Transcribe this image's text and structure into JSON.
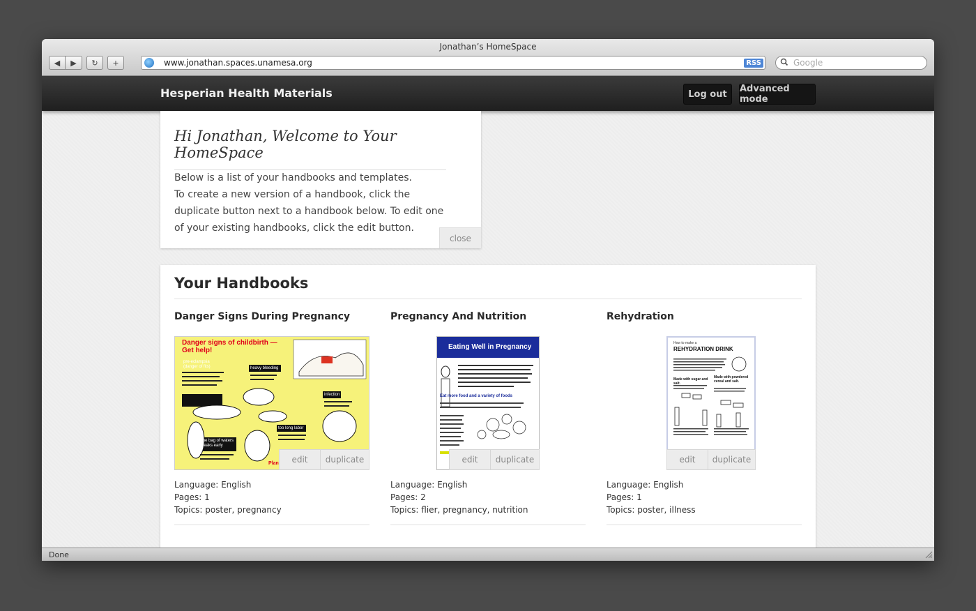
{
  "window": {
    "title": "Jonathan’s HomeSpace",
    "status": "Done"
  },
  "toolbar": {
    "back_icon": "◀",
    "forward_icon": "▶",
    "reload_icon": "↻",
    "add_icon": "+",
    "url": "www.jonathan.spaces.unamesa.org",
    "rss_label": "RSS",
    "search_placeholder": "Google"
  },
  "header": {
    "brand": "Hesperian Health Materials",
    "logout_label": "Log out",
    "advanced_label": "Advanced mode"
  },
  "welcome": {
    "title": "Hi Jonathan, Welcome to Your HomeSpace",
    "line1": "Below is a list of your handbooks and templates.",
    "line2": "To create a new version of a handbook, click the duplicate button next to a handbook below. To edit one of your existing handbooks, click the edit button.",
    "close_label": "close"
  },
  "handbooks": {
    "heading": "Your Handbooks",
    "items": [
      {
        "title": "Danger Signs During Pregnancy",
        "edit_label": "edit",
        "duplicate_label": "duplicate",
        "language": "Language: English",
        "pages": "Pages: 1",
        "topics": "Topics: poster, pregnancy",
        "thumb": {
          "title": "Danger signs of childbirth — Get help!",
          "l1": "pre-eclampsia (danger of fits)",
          "l2": "heavy bleeding",
          "l3": "infection",
          "l4": "too long labor",
          "l5": "The bag of waters breaks early",
          "l6": "Plan"
        }
      },
      {
        "title": "Pregnancy And Nutrition",
        "edit_label": "edit",
        "duplicate_label": "duplicate",
        "language": "Language: English",
        "pages": "Pages: 2",
        "topics": "Topics: flier, pregnancy, nutrition",
        "thumb": {
          "title": "Eating Well in Pregnancy",
          "sub": "Eat more food and a variety of foods"
        }
      },
      {
        "title": "Rehydration",
        "edit_label": "edit",
        "duplicate_label": "duplicate",
        "language": "Language: English",
        "pages": "Pages: 1",
        "topics": "Topics: poster, illness",
        "thumb": {
          "pre": "How to make a",
          "title": "REHYDRATION DRINK",
          "a": "Made with sugar and salt.",
          "b": "Made with powdered cereal and salt."
        }
      }
    ]
  },
  "colors": {
    "topbar": "#2b2b2b",
    "poster_yellow": "#f6f27a",
    "flier_blue": "#1b2d9b",
    "poster_red": "#e0001b"
  }
}
